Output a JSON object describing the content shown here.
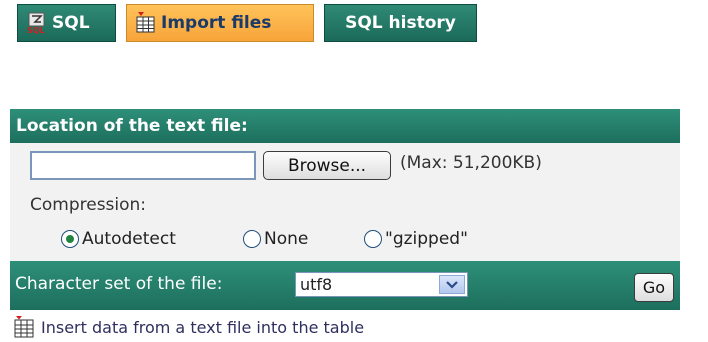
{
  "tabs": [
    {
      "label": "SQL",
      "icon": "sql-icon"
    },
    {
      "label": "Import files",
      "icon": "import-table-icon"
    },
    {
      "label": "SQL history",
      "icon": ""
    }
  ],
  "active_tab": "Import files",
  "import_panel": {
    "title": "Location of the text file:",
    "file_input_value": "",
    "browse_label": "Browse...",
    "max_label": "(Max: 51,200KB)",
    "compression_label": "Compression:",
    "compression_options": [
      {
        "label": "Autodetect",
        "selected": true
      },
      {
        "label": "None",
        "selected": false
      },
      {
        "label": "\"gzipped\"",
        "selected": false
      }
    ]
  },
  "charset": {
    "label": "Character set of the file:",
    "selected": "utf8",
    "go_label": "Go"
  },
  "footer": {
    "link_label": "Insert data from a text file into the table",
    "icon": "table-insert-icon"
  },
  "colors": {
    "panel_green": "#1d6f5d",
    "active_tab_orange": "#f7a43a",
    "radio_selected": "#23843f"
  }
}
